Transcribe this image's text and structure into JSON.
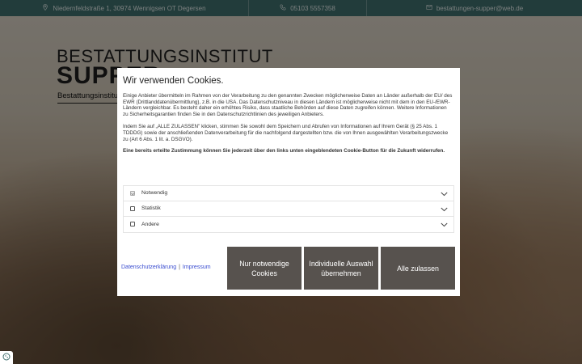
{
  "topbar": {
    "address": "Niedernfeldstraße 1, 30974 Wennigsen OT Degersen",
    "phone": "05103 5557358",
    "email": "bestattungen-supper@web.de"
  },
  "logo": {
    "line1": "BESTATTUNGSINSTITUT",
    "line2": "SUPPER"
  },
  "nav": {
    "label": "Bestattungsinstitut"
  },
  "cookie": {
    "title": "Wir verwenden Cookies.",
    "para1": "Einige Anbieter übermitteln im Rahmen von der Verarbeitung zu den genannten Zwecken möglicherweise Daten an Länder außerhalb der EU/ des EWR (Drittlanddatenübermittlung), z.B. in die USA. Das Datenschutzniveau in diesen Ländern ist möglicherweise nicht mit dem in den EU-/EWR-Ländern vergleichbar. Es besteht daher ein erhöhtes Risiko, dass staatliche Behörden auf diese Daten zugreifen können. Weitere Informationen zu Sicherheitsgarantien finden Sie in den Datenschutzrichtlinien des jeweiligen Anbieters.",
    "para2": "Indem Sie auf „ALLE ZULASSEN\" klicken, stimmen Sie sowohl dem Speichern und Abrufen von Informationen auf Ihrem Gerät (§ 25 Abs. 1 TDDDG) sowie der anschließenden Datenverarbeitung für die nachfolgend dargestellten bzw. die von Ihnen ausgewählten Verarbeitungszwecke zu (Art 6 Abs. 1 lit. a. DSGVO).",
    "para3": "Eine bereits erteilte Zustimmung können Sie jederzeit über den links unten eingeblendeten Cookie-Button für die Zukunft widerrufen.",
    "options": [
      {
        "label": "Notwendig"
      },
      {
        "label": "Statistik"
      },
      {
        "label": "Andere"
      }
    ],
    "link_privacy": "Datenschutzerklärung",
    "link_separator": "|",
    "link_imprint": "Impressum",
    "btn_necessary": "Nur notwendige Cookies",
    "btn_individual": "Individuelle Auswahl übernehmen",
    "btn_all": "Alle zulassen"
  },
  "colors": {
    "topbar": "#3f6e6c",
    "button": "#57524e",
    "link": "#3b4ed0"
  }
}
